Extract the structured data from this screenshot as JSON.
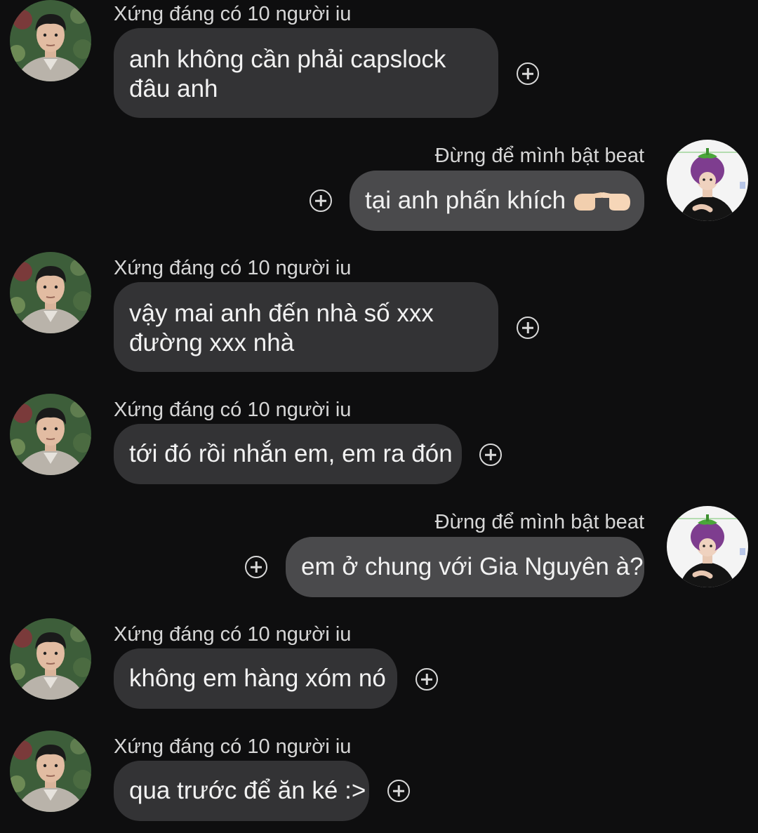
{
  "contacts": {
    "other": {
      "name": "Xứng đáng có 10 người iu",
      "avatar_icon": "boy-portrait-avatar"
    },
    "me": {
      "name": "Đừng để mình bật beat",
      "avatar_icon": "eggplant-hat-avatar"
    }
  },
  "messages": [
    {
      "sender": "other",
      "sender_name": "Xứng đáng có 10 người iu",
      "text": "anh không cần phải capslock\nđâu anh"
    },
    {
      "sender": "me",
      "sender_name": "Đừng để mình bật beat",
      "text": "tại anh phấn khích",
      "emoji": "pointing-hands-emoji"
    },
    {
      "sender": "other",
      "sender_name": "Xứng đáng có 10 người iu",
      "text": "vậy mai anh đến nhà số xxx\nđường xxx nhà"
    },
    {
      "sender": "other",
      "sender_name": "Xứng đáng có 10 người iu",
      "text": "tới đó rồi nhắn em, em ra đón"
    },
    {
      "sender": "me",
      "sender_name": "Đừng để mình bật beat",
      "text": "em ở chung với Gia Nguyên à?"
    },
    {
      "sender": "other",
      "sender_name": "Xứng đáng có 10 người iu",
      "text": "không em hàng xóm nó"
    },
    {
      "sender": "other",
      "sender_name": "Xứng đáng có 10 người iu",
      "text": "qua trước để ăn ké :>"
    }
  ],
  "colors": {
    "background": "#0e0e0f",
    "incoming_bubble": "#333335",
    "outgoing_bubble": "#4a4a4c",
    "text": "#f2f2f2",
    "name_text": "#d6d6d6"
  }
}
